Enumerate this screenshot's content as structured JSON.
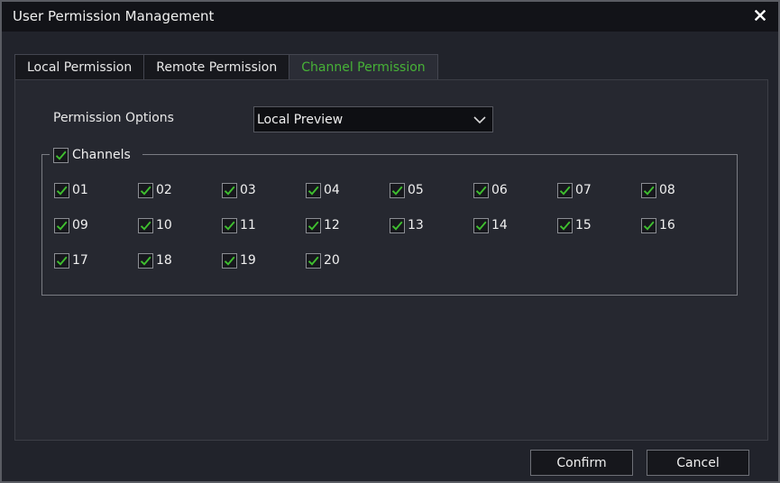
{
  "window": {
    "title": "User Permission Management"
  },
  "tabs": [
    {
      "label": "Local Permission",
      "active": false
    },
    {
      "label": "Remote Permission",
      "active": false
    },
    {
      "label": "Channel Permission",
      "active": true
    }
  ],
  "permission_options": {
    "label": "Permission Options",
    "selected": "Local Preview"
  },
  "channels_group": {
    "label": "Channels",
    "checked": true
  },
  "channels": [
    {
      "label": "01",
      "checked": true
    },
    {
      "label": "02",
      "checked": true
    },
    {
      "label": "03",
      "checked": true
    },
    {
      "label": "04",
      "checked": true
    },
    {
      "label": "05",
      "checked": true
    },
    {
      "label": "06",
      "checked": true
    },
    {
      "label": "07",
      "checked": true
    },
    {
      "label": "08",
      "checked": true
    },
    {
      "label": "09",
      "checked": true
    },
    {
      "label": "10",
      "checked": true
    },
    {
      "label": "11",
      "checked": true
    },
    {
      "label": "12",
      "checked": true
    },
    {
      "label": "13",
      "checked": true
    },
    {
      "label": "14",
      "checked": true
    },
    {
      "label": "15",
      "checked": true
    },
    {
      "label": "16",
      "checked": true
    },
    {
      "label": "17",
      "checked": true
    },
    {
      "label": "18",
      "checked": true
    },
    {
      "label": "19",
      "checked": true
    },
    {
      "label": "20",
      "checked": true
    }
  ],
  "buttons": {
    "confirm": "Confirm",
    "cancel": "Cancel"
  },
  "colors": {
    "accent": "#47b237",
    "check": "#3fbf2f"
  }
}
